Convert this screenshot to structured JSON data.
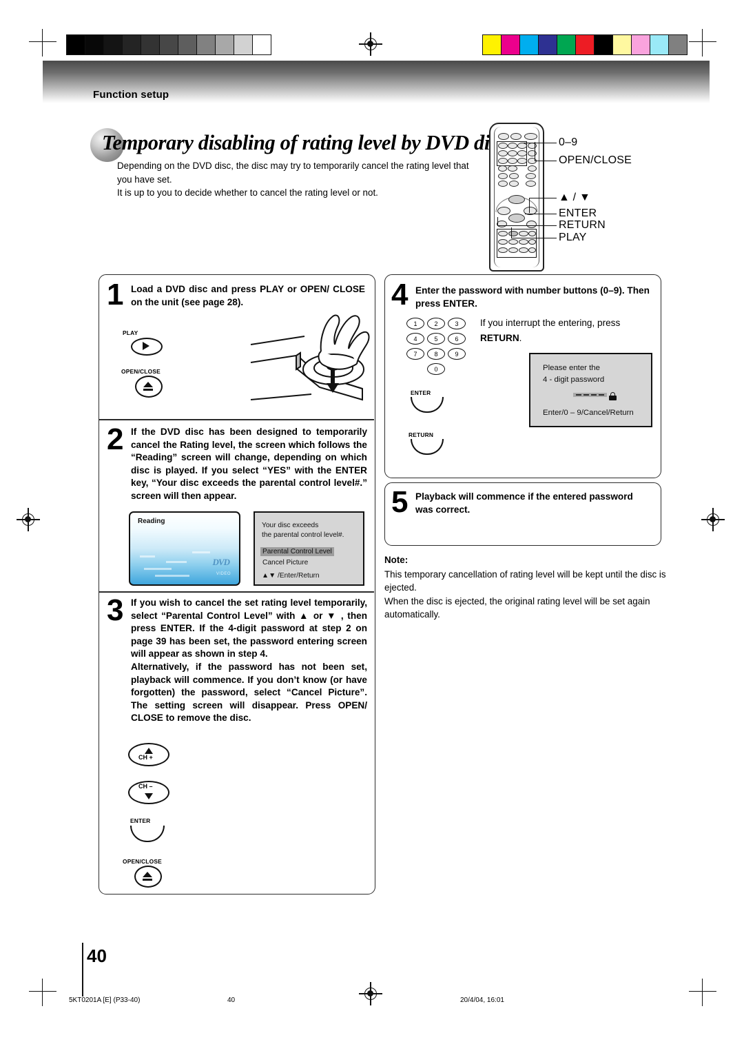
{
  "header": {
    "section_label": "Function setup"
  },
  "title": "Temporary disabling of rating level by DVD disc",
  "intro": "Depending on the DVD disc, the disc may try to temporarily cancel the rating level that you have set.\nIt is up to you to decide whether to cancel the rating level or not.",
  "remote_callouts": [
    {
      "label": "0–9"
    },
    {
      "label": "OPEN/CLOSE"
    },
    {
      "label": "▲ / ▼"
    },
    {
      "label": "ENTER"
    },
    {
      "label": "RETURN"
    },
    {
      "label": "PLAY"
    }
  ],
  "steps": [
    {
      "number": "1",
      "text": "Load a DVD disc and press PLAY or OPEN/ CLOSE on the unit (see page 28)."
    },
    {
      "number": "2",
      "text": "If the DVD disc has been designed to temporarily cancel the Rating level, the screen which follows the “Reading” screen will change, depending on which disc is played. If you select “YES” with the ENTER key, “Your disc exceeds the parental control level#.” screen will then appear."
    },
    {
      "number": "3",
      "text": "If you wish to cancel the set rating level temporarily, select “Parental Control Level” with ▲ or ▼ , then press ENTER. If the 4-digit password at step 2 on page 39 has been set, the password entering screen will appear as shown in step 4.\nAlternatively, if the password has not been set, playback will commence. If you don’t know (or have forgotten) the password, select “Cancel Picture”. The setting screen will disappear. Press OPEN/ CLOSE to remove the disc."
    },
    {
      "number": "4",
      "text": "Enter the password with number buttons (0–9). Then press ENTER."
    },
    {
      "number": "5",
      "text": "Playback will commence if the entered password was correct."
    }
  ],
  "step1_buttons": [
    {
      "label": "PLAY",
      "icon": "play-icon"
    },
    {
      "label": "OPEN/CLOSE",
      "icon": "eject-icon"
    }
  ],
  "step3_buttons": [
    {
      "label": "CH +",
      "icon": "channel-up-icon"
    },
    {
      "label": "CH –",
      "icon": "channel-down-icon"
    },
    {
      "label": "ENTER",
      "icon": "enter-key-icon"
    },
    {
      "label": "OPEN/CLOSE",
      "icon": "eject-icon"
    }
  ],
  "step4": {
    "keypad": [
      "1",
      "2",
      "3",
      "4",
      "5",
      "6",
      "7",
      "8",
      "9",
      "0"
    ],
    "buttons": [
      {
        "label": "ENTER",
        "icon": "enter-key-icon"
      },
      {
        "label": "RETURN",
        "icon": "return-key-icon"
      }
    ],
    "interrupt_note_plain": "If you interrupt the entering, press",
    "interrupt_note_bold": "RETURN",
    "interrupt_note_period": "."
  },
  "reading_screen": {
    "label": "Reading",
    "logo": "DVD",
    "logo_sub": "VIDEO"
  },
  "parental_screen": {
    "line1": "Your disc exceeds",
    "line2": "the parental control level#.",
    "option_selected": "Parental Control Level",
    "option_other": "Cancel Picture",
    "hint": "▲▼ /Enter/Return"
  },
  "password_screen": {
    "line1": "Please enter the",
    "line2": "4 - digit password",
    "field_value": "– – – –",
    "lock_icon": "lock-icon",
    "hint": "Enter/0 – 9/Cancel/Return"
  },
  "note": {
    "heading": "Note:",
    "body": "This temporary cancellation of rating level will be kept until the disc is ejected.\nWhen the disc is ejected, the original rating level will be set again automatically."
  },
  "footer": {
    "page_number": "40",
    "doc_code": "5KT0201A [E] (P33-40)",
    "page_label": "40",
    "timestamp": "20/4/04, 16:01"
  },
  "print_marks": {
    "gray_wedge": [
      "#000000",
      "#080808",
      "#141414",
      "#242424",
      "#333333",
      "#474747",
      "#5e5e5e",
      "#818181",
      "#a8a8a8",
      "#d2d2d2",
      "#ffffff"
    ],
    "color_bar": [
      "#fff200",
      "#ec008c",
      "#00aeef",
      "#2e3192",
      "#00a651",
      "#ed1c24",
      "#000000",
      "#fff8a0",
      "#f9a3dd",
      "#9ae9f7",
      "#808080"
    ]
  }
}
